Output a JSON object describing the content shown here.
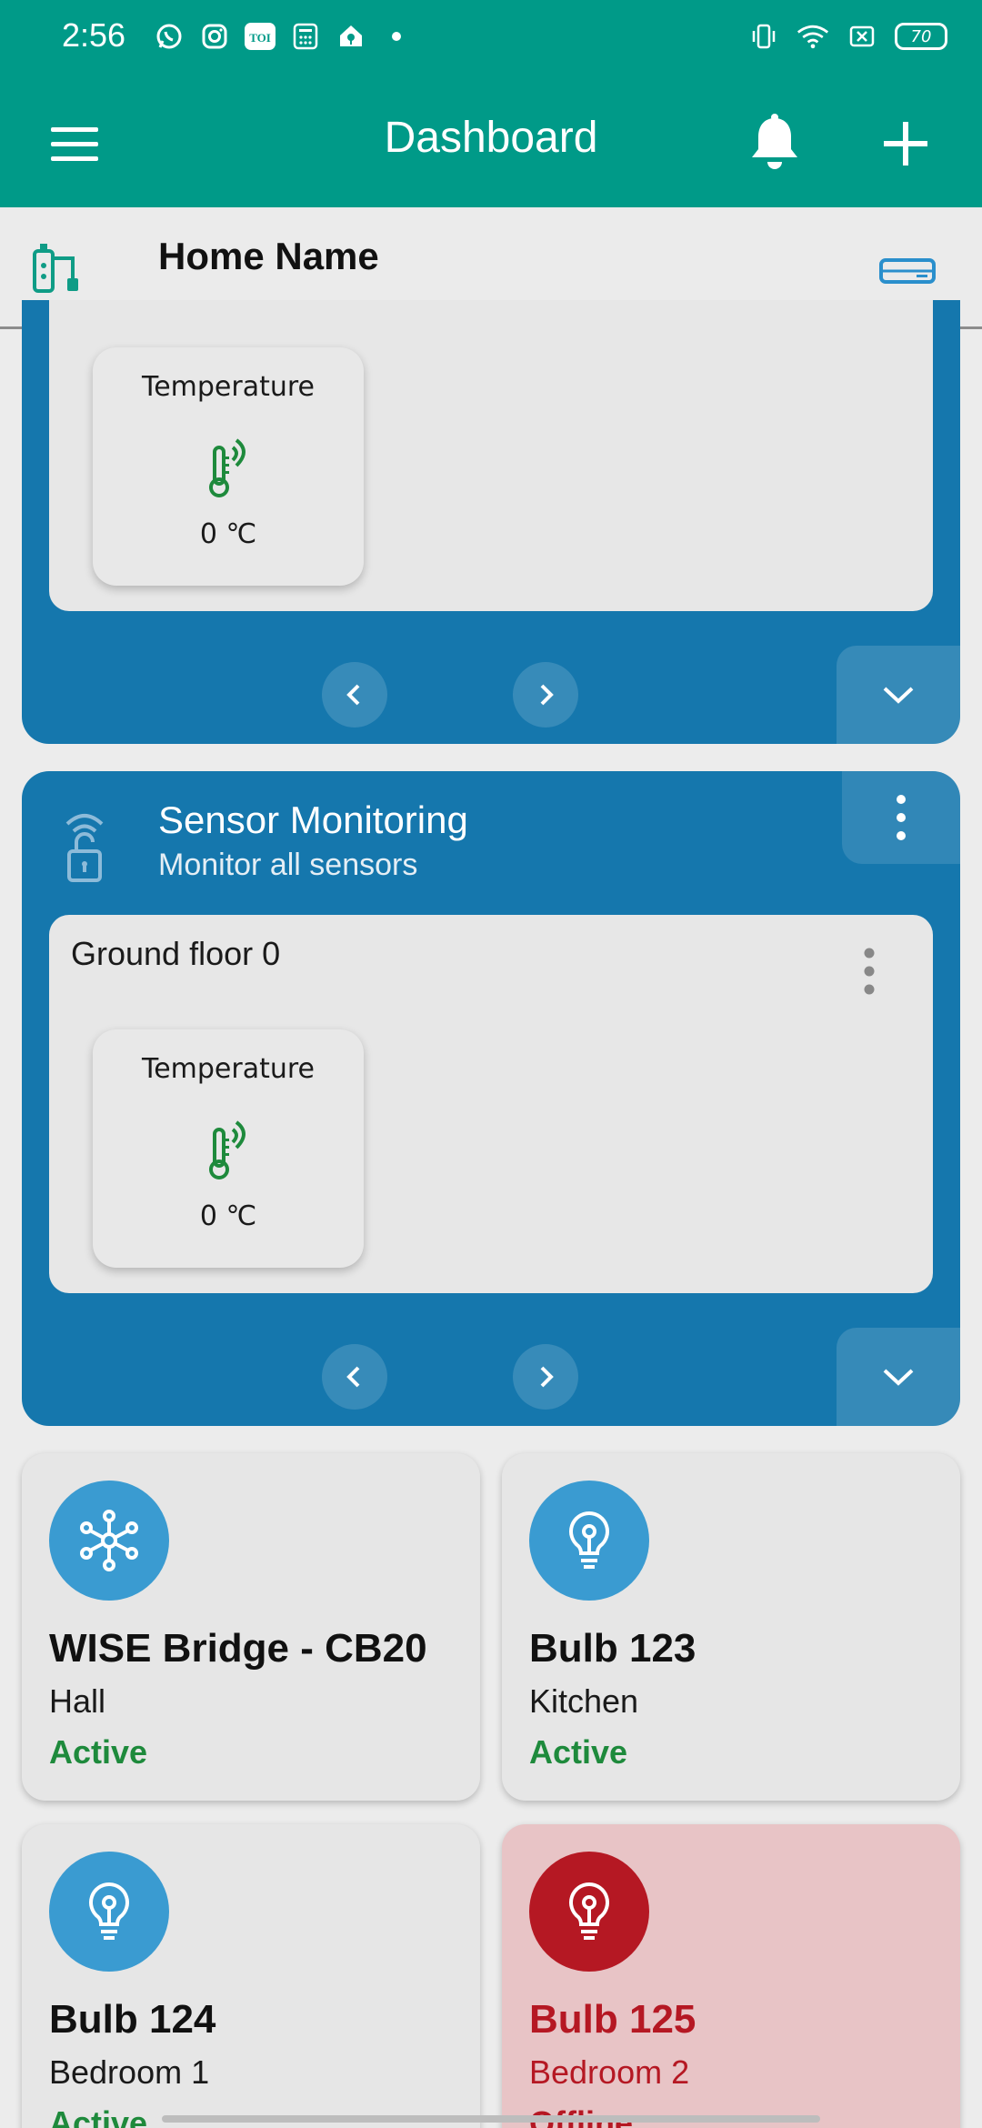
{
  "status_bar": {
    "time": "2:56",
    "battery": "70"
  },
  "app_bar": {
    "title": "Dashboard"
  },
  "home": {
    "name": "Home Name"
  },
  "panel_top": {
    "sensor": {
      "label": "Temperature",
      "value": "0 ℃"
    }
  },
  "panel_sensor": {
    "title": "Sensor Monitoring",
    "subtitle": "Monitor all sensors",
    "floor": "Ground floor 0",
    "sensor": {
      "label": "Temperature",
      "value": "0 ℃"
    }
  },
  "devices": [
    {
      "name": "WISE Bridge - CB20",
      "room": "Hall",
      "status": "Active",
      "icon": "hub-icon"
    },
    {
      "name": "Bulb 123",
      "room": "Kitchen",
      "status": "Active",
      "icon": "bulb-icon"
    },
    {
      "name": "Bulb 124",
      "room": "Bedroom 1",
      "status": "Active",
      "icon": "bulb-icon"
    },
    {
      "name": "Bulb 125",
      "room": "Bedroom 2",
      "status": "Offline",
      "icon": "bulb-icon"
    }
  ],
  "colors": {
    "primary": "#009a88",
    "panel": "#1577ad",
    "active": "#1e8a3c",
    "offline": "#b51823",
    "device_icon": "#3a9bd1"
  }
}
